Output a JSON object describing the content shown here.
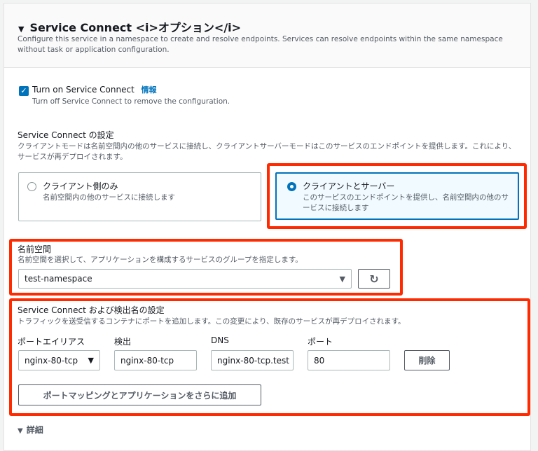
{
  "section": {
    "title": "Service Connect <i>オプション</i>",
    "description": "Configure this service in a namespace to create and resolve endpoints. Services can resolve endpoints within the same namespace without task or application configuration."
  },
  "toggle": {
    "label": "Turn on Service Connect",
    "info": "情報",
    "help": "Turn off Service Connect to remove the configuration.",
    "checked": true
  },
  "config": {
    "label": "Service Connect の設定",
    "description": "クライアントモードは名前空間内の他のサービスに接続し、クライアントサーバーモードはこのサービスのエンドポイントを提供します。これにより、サービスが再デプロイされます。",
    "options": [
      {
        "title": "クライアント側のみ",
        "desc": "名前空間内の他のサービスに接続します",
        "selected": false
      },
      {
        "title": "クライアントとサーバー",
        "desc": "このサービスのエンドポイントを提供し、名前空間内の他のサービスに接続します",
        "selected": true
      }
    ]
  },
  "namespace": {
    "label": "名前空間",
    "description": "名前空間を選択して、アプリケーションを構成するサービスのグループを指定します。",
    "value": "test-namespace"
  },
  "mapping": {
    "label": "Service Connect および検出名の設定",
    "description": "トラフィックを送受信するコンテナにポートを追加します。この変更により、既存のサービスが再デプロイされます。",
    "columns": [
      "ポートエイリアス",
      "検出",
      "DNS",
      "ポート"
    ],
    "row": {
      "alias": "nginx-80-tcp",
      "discovery": "nginx-80-tcp",
      "dns": "nginx-80-tcp.test",
      "port": "80"
    },
    "remove": "削除",
    "add": "ポートマッピングとアプリケーションをさらに追加"
  },
  "details": "詳細"
}
